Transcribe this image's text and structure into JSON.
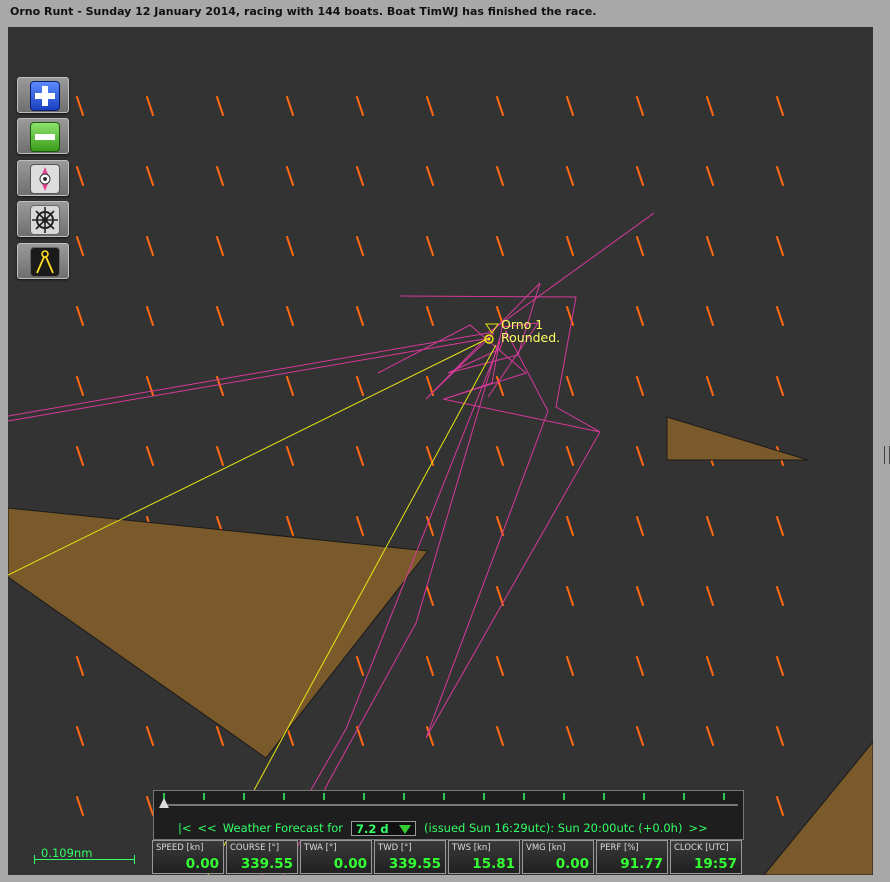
{
  "title": "Orno Runt - Sunday 12 January 2014, racing with 144 boats. Boat TimWJ has finished the race.",
  "colors": {
    "sea": "#333333",
    "land": "#7a5a2a",
    "wind_arrow": "#ff6a13",
    "track": "#d6399a",
    "course_line": "#e6e614",
    "hud_text": "#33ff66"
  },
  "toolbar": [
    {
      "name": "zoom-in-button",
      "icon": "plus-icon"
    },
    {
      "name": "zoom-out-button",
      "icon": "minus-icon"
    },
    {
      "name": "center-boat-button",
      "icon": "compass-icon"
    },
    {
      "name": "helm-button",
      "icon": "ship-wheel-icon"
    },
    {
      "name": "measure-button",
      "icon": "divider-compass-icon"
    }
  ],
  "mark": {
    "name": "Orno 1",
    "status": "Rounded."
  },
  "scale": {
    "label": "0.109nm"
  },
  "forecast": {
    "first": "|<",
    "prev": "<<",
    "label": "Weather Forecast for",
    "selected": "7.2 d",
    "issued": "(issued Sun 16:29utc): Sun 20:00utc  (+0.0h)",
    "next": ">>"
  },
  "stats": [
    {
      "label": "SPEED [kn]",
      "value": "0.00"
    },
    {
      "label": "COURSE [°]",
      "value": "339.55"
    },
    {
      "label": "TWA [°]",
      "value": "0.00"
    },
    {
      "label": "TWD [°]",
      "value": "339.55"
    },
    {
      "label": "TWS [kn]",
      "value": "15.81"
    },
    {
      "label": "VMG [kn]",
      "value": "0.00"
    },
    {
      "label": "PERF [%]",
      "value": "91.77"
    },
    {
      "label": "CLOCK [UTC]",
      "value": "19:57"
    }
  ]
}
